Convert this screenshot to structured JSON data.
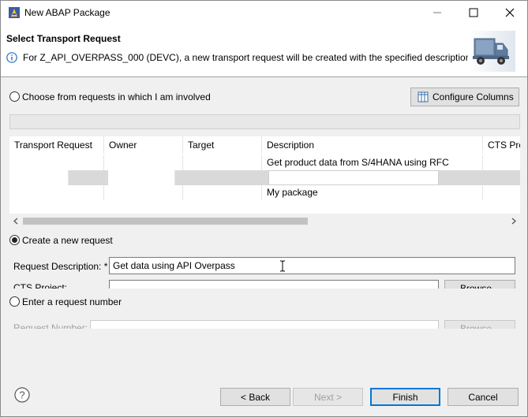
{
  "window": {
    "title": "New ABAP Package",
    "controls": {
      "minimize": "minimize-icon",
      "maximize": "maximize-icon",
      "close": "close-icon"
    }
  },
  "header": {
    "title": "Select Transport Request",
    "message": "For Z_API_OVERPASS_000 (DEVC), a new transport request will be created with the specified description",
    "icon": "truck-icon"
  },
  "involved": {
    "radio_label": "Choose from requests in which I am involved",
    "selected": false,
    "configure_columns_label": "Configure Columns"
  },
  "table": {
    "columns": [
      "Transport Request",
      "Owner",
      "Target",
      "Description",
      "CTS Pro"
    ],
    "rows": [
      {
        "request": "",
        "owner": "",
        "target": "",
        "description": "Get product data from S/4HANA using RFC"
      },
      {
        "request": "",
        "owner": "",
        "target": "",
        "description": ""
      },
      {
        "request": "",
        "owner": "",
        "target": "",
        "description": "My package"
      }
    ]
  },
  "create_new": {
    "radio_label": "Create a new request",
    "selected": true,
    "description_label": "Request Description: *",
    "description_value": "Get data using API Overpass",
    "cts_project_label": "CTS Project:",
    "browse_label": "Browse..."
  },
  "enter_number": {
    "radio_label": "Enter a request number",
    "selected": false,
    "number_label": "Request Number:",
    "browse_label": "Browse..."
  },
  "footer": {
    "help": "?",
    "back_label": "< Back",
    "next_label": "Next >",
    "finish_label": "Finish",
    "cancel_label": "Cancel"
  }
}
